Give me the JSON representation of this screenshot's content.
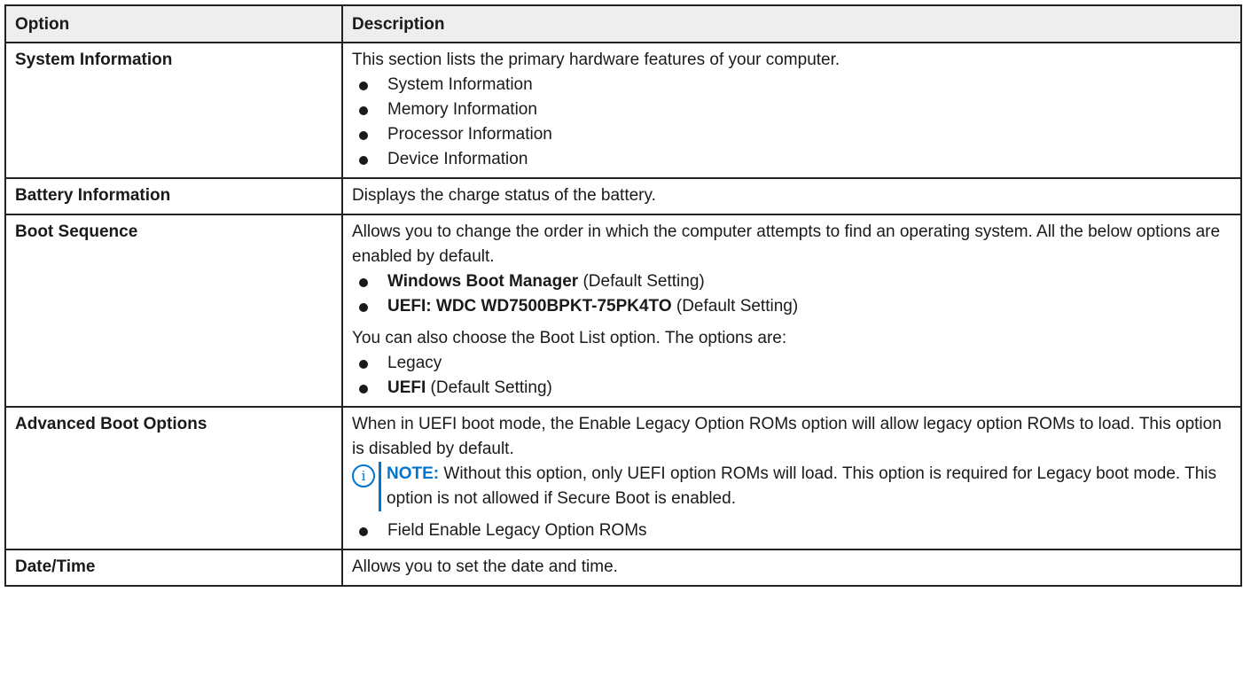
{
  "table": {
    "headers": [
      "Option",
      "Description"
    ],
    "rows": [
      {
        "option": "System Information",
        "intro": "This section lists the primary hardware features of your computer.",
        "items": [
          "System Information",
          "Memory Information",
          "Processor Information",
          "Device Information"
        ]
      },
      {
        "option": "Battery Information",
        "intro": "Displays the charge status of the battery."
      },
      {
        "option": "Boot Sequence",
        "intro": "Allows you to change the order in which the computer attempts to find an operating system. All the below options are enabled by default.",
        "items": [
          {
            "bold": "Windows Boot Manager",
            "rest": " (Default Setting)"
          },
          {
            "bold": "UEFI: WDC WD7500BPKT-75PK4TO",
            "rest": " (Default Setting)"
          }
        ],
        "intro2": "You can also choose the Boot List option. The options are:",
        "items2": [
          {
            "bold": "",
            "rest": "Legacy"
          },
          {
            "bold": "UEFI",
            "rest": " (Default Setting)"
          }
        ]
      },
      {
        "option": "Advanced Boot Options",
        "intro": "When in UEFI boot mode, the Enable Legacy Option ROMs option will allow legacy option ROMs to load. This option is disabled by default.",
        "note_label": "NOTE:",
        "note_text": " Without this option, only UEFI option ROMs will load. This option is required for Legacy boot mode. This option is not allowed if Secure Boot is enabled.",
        "items": [
          "Field Enable Legacy Option ROMs"
        ]
      },
      {
        "option": "Date/Time",
        "intro": "Allows you to set the date and time."
      }
    ]
  },
  "icons": {
    "note": "info-circle-icon",
    "note_glyph": "i",
    "note_color": "#0076ce"
  }
}
